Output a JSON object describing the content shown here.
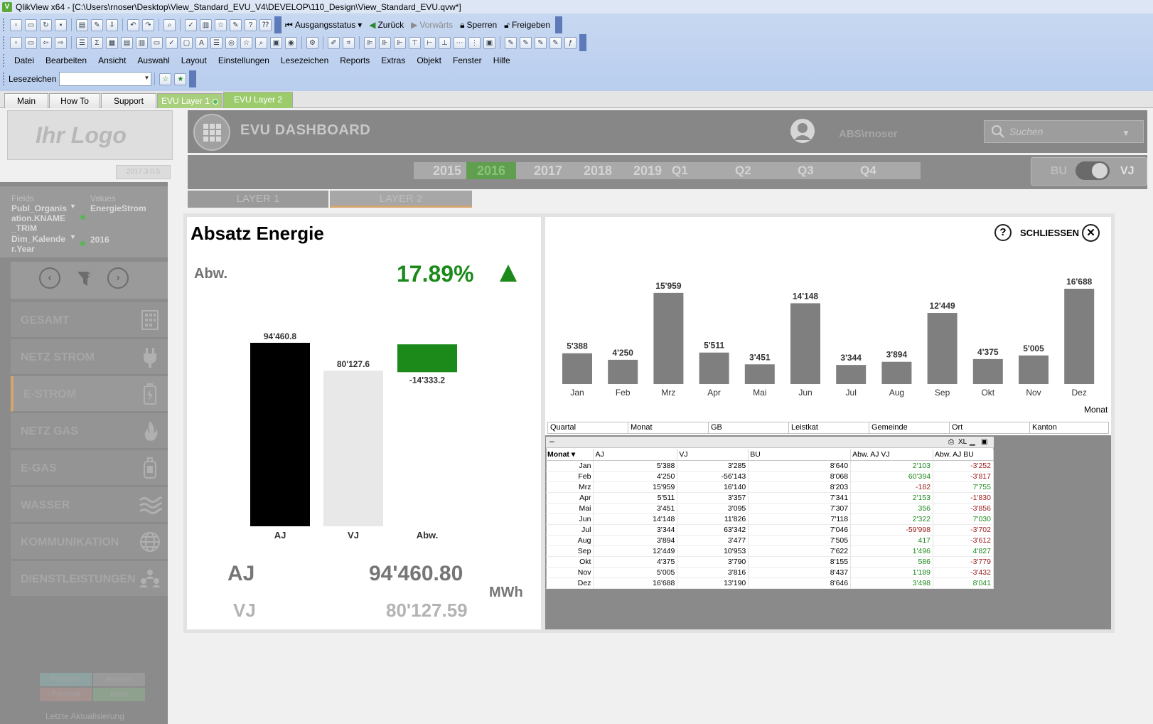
{
  "window": {
    "title": "QlikView x64 - [C:\\Users\\rnoser\\Desktop\\View_Standard_EVU_V4\\DEVELOP\\110_Design\\View_Standard_EVU.qvw*]"
  },
  "toolbar": {
    "ausgangsstatus": "Ausgangsstatus",
    "zurueck": "Zurück",
    "vorwaerts": "Vorwärts",
    "sperren": "Sperren",
    "freigeben": "Freigeben"
  },
  "menu": [
    "Datei",
    "Bearbeiten",
    "Ansicht",
    "Auswahl",
    "Layout",
    "Einstellungen",
    "Lesezeichen",
    "Reports",
    "Extras",
    "Objekt",
    "Fenster",
    "Hilfe"
  ],
  "bookmarks": {
    "label": "Lesezeichen",
    "value": ""
  },
  "sheet_tabs": [
    "Main",
    "How To",
    "Support",
    "EVU Layer 1",
    "EVU Layer 2"
  ],
  "header": {
    "logo": "Ihr Logo",
    "version": "2017.3.0.5",
    "title": "EVU DASHBOARD",
    "user": "ABS\\rnoser",
    "search_placeholder": "Suchen"
  },
  "filters": {
    "years": [
      "2015",
      "2016",
      "2017",
      "2018",
      "2019"
    ],
    "selected_year": "2016",
    "quarters": [
      "Q1",
      "Q2",
      "Q3",
      "Q4"
    ],
    "toggle_left": "BU",
    "toggle_right": "VJ"
  },
  "layers": [
    "LAYER 1",
    "LAYER 2"
  ],
  "current_selections": {
    "fields_header": "Fields",
    "values_header": "Values",
    "rows": [
      {
        "field": "Publ_Organisation.KNAME_TRIM",
        "value": "EnergieStrom"
      },
      {
        "field": "Dim_Kalender.Year",
        "value": "2016"
      }
    ]
  },
  "sidebar": {
    "items": [
      {
        "label": "GESAMT",
        "icon": "building-icon"
      },
      {
        "label": "NETZ STROM",
        "icon": "plug-icon"
      },
      {
        "label": "E-STROM",
        "icon": "battery-icon"
      },
      {
        "label": "NETZ GAS",
        "icon": "flame-icon"
      },
      {
        "label": "E-GAS",
        "icon": "gas-cylinder-icon"
      },
      {
        "label": "WASSER",
        "icon": "water-waves-icon"
      },
      {
        "label": "KOMMUNIKATION",
        "icon": "globe-icon"
      },
      {
        "label": "DIENSTLEISTUNGEN",
        "icon": "people-icon"
      }
    ],
    "active": "E-STROM",
    "legend": [
      "Finanzen",
      "Anlagen",
      "Personal",
      "Markt"
    ],
    "last_update": "Letzte Aktualisierung"
  },
  "panel": {
    "title": "Absatz Energie",
    "abw_label": "Abw.",
    "abw_value": "17.89%",
    "kpi_aj_label": "AJ",
    "kpi_aj_value": "94'460.80",
    "kpi_vj_label": "VJ",
    "kpi_vj_value": "80'127.59",
    "unit": "MWh",
    "help": "?",
    "close_label": "SCHLIESSEN",
    "close_icon": "✕"
  },
  "colors": {
    "positive": "#1b8a1b",
    "negative": "#9c1a1a",
    "bar_grey": "#7f7f7f",
    "aj": "#000000",
    "vj": "#e8e8e8"
  },
  "chart_data": [
    {
      "type": "bar",
      "categories": [
        "AJ",
        "VJ",
        "Abw."
      ],
      "values": [
        94460.8,
        80127.6,
        -14333.2
      ],
      "value_labels": [
        "94'460.8",
        "80'127.6",
        "-14'333.2"
      ],
      "colors": [
        "#000000",
        "#e8e8e8",
        "#1b8a1b"
      ]
    },
    {
      "type": "bar",
      "categories": [
        "Jan",
        "Feb",
        "Mrz",
        "Apr",
        "Mai",
        "Jun",
        "Jul",
        "Aug",
        "Sep",
        "Okt",
        "Nov",
        "Dez"
      ],
      "values": [
        5388,
        4250,
        15959,
        5511,
        3451,
        14148,
        3344,
        3894,
        12449,
        4375,
        5005,
        16688
      ],
      "value_labels": [
        "5'388",
        "4'250",
        "15'959",
        "5'511",
        "3'451",
        "14'148",
        "3'344",
        "3'894",
        "12'449",
        "4'375",
        "5'005",
        "16'688"
      ],
      "xlabel": "Monat",
      "ylim": [
        0,
        16688
      ]
    }
  ],
  "listboxes": [
    "Quartal",
    "Monat",
    "GB",
    "Leistkat",
    "Gemeinde",
    "Ort",
    "Kanton"
  ],
  "table": {
    "columns": [
      "Monat",
      "AJ",
      "VJ",
      "BU",
      "Abw. AJ VJ",
      "Abw. AJ BU"
    ],
    "rows": [
      [
        "Jan",
        "5'388",
        "3'285",
        "8'640",
        "2'103",
        "-3'252"
      ],
      [
        "Feb",
        "4'250",
        "-56'143",
        "8'068",
        "60'394",
        "-3'817"
      ],
      [
        "Mrz",
        "15'959",
        "16'140",
        "8'203",
        "-182",
        "7'755"
      ],
      [
        "Apr",
        "5'511",
        "3'357",
        "7'341",
        "2'153",
        "-1'830"
      ],
      [
        "Mai",
        "3'451",
        "3'095",
        "7'307",
        "356",
        "-3'856"
      ],
      [
        "Jun",
        "14'148",
        "11'826",
        "7'118",
        "2'322",
        "7'030"
      ],
      [
        "Jul",
        "3'344",
        "63'342",
        "7'046",
        "-59'998",
        "-3'702"
      ],
      [
        "Aug",
        "3'894",
        "3'477",
        "7'505",
        "417",
        "-3'612"
      ],
      [
        "Sep",
        "12'449",
        "10'953",
        "7'622",
        "1'496",
        "4'827"
      ],
      [
        "Okt",
        "4'375",
        "3'790",
        "8'155",
        "586",
        "-3'779"
      ],
      [
        "Nov",
        "5'005",
        "3'816",
        "8'437",
        "1'189",
        "-3'432"
      ],
      [
        "Dez",
        "16'688",
        "13'190",
        "8'646",
        "3'498",
        "8'041"
      ]
    ]
  }
}
